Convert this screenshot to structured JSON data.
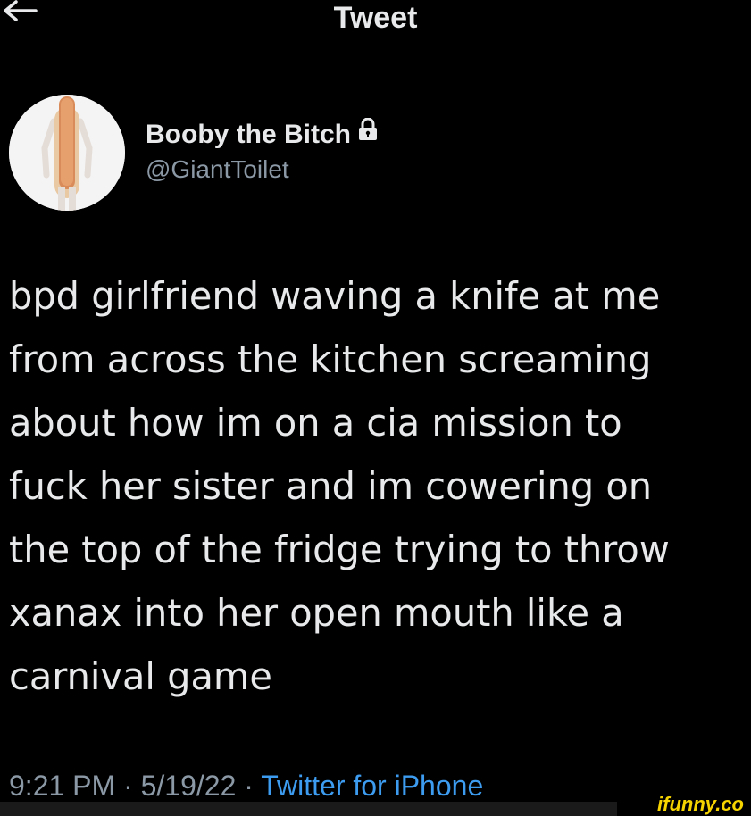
{
  "header": {
    "title": "Tweet",
    "back_icon": "arrow-left-icon"
  },
  "author": {
    "display_name": "Booby the Bitch",
    "handle": "@GiantToilet",
    "protected_icon": "lock-icon",
    "avatar_icon": "hot-dog-costume-avatar"
  },
  "tweet": {
    "text": "bpd girlfriend waving a knife at me\nfrom across the kitchen screaming\nabout how im on a cia mission to\nfuck her sister and im cowering on\nthe top of the fridge trying to throw\nxanax into her open mouth like a\ncarnival game",
    "time": "9:21 PM",
    "separator": "·",
    "date": "5/19/22",
    "source": "Twitter for iPhone"
  },
  "watermark": {
    "text": "ifunny.co"
  },
  "colors": {
    "background": "#000000",
    "text": "#e7e9ea",
    "secondary": "#8b98a5",
    "link": "#3d9cf0",
    "watermark": "#f5d400"
  }
}
